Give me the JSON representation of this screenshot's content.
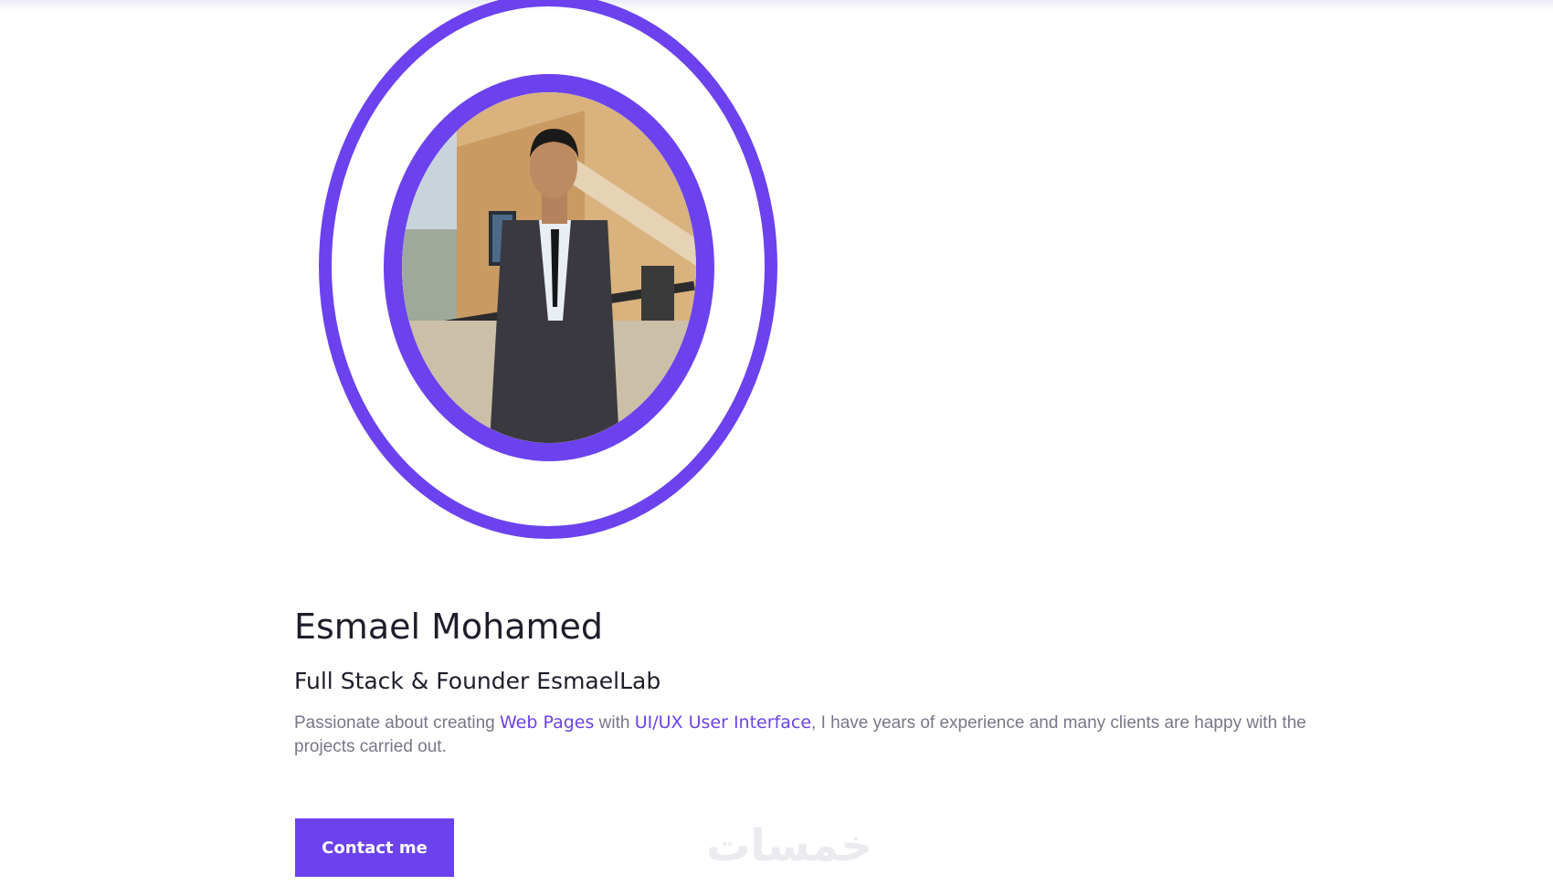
{
  "profile": {
    "name": "Esmael Mohamed",
    "role": "Full Stack & Founder EsmaelLab",
    "bio": {
      "part1": "Passionate about creating ",
      "highlight1": "Web Pages",
      "part2": " with ",
      "highlight2": "UI/UX User Interface",
      "part3": ", I have years of experience and many clients are happy with the projects carried out."
    }
  },
  "actions": {
    "contact_label": "Contact me"
  },
  "watermark": {
    "text": "خمسات"
  },
  "colors": {
    "accent": "#6b42ee",
    "heading": "#1f1d2b",
    "body_text": "#7a7688"
  },
  "icons": {
    "profile_photo": "profile-photo"
  }
}
